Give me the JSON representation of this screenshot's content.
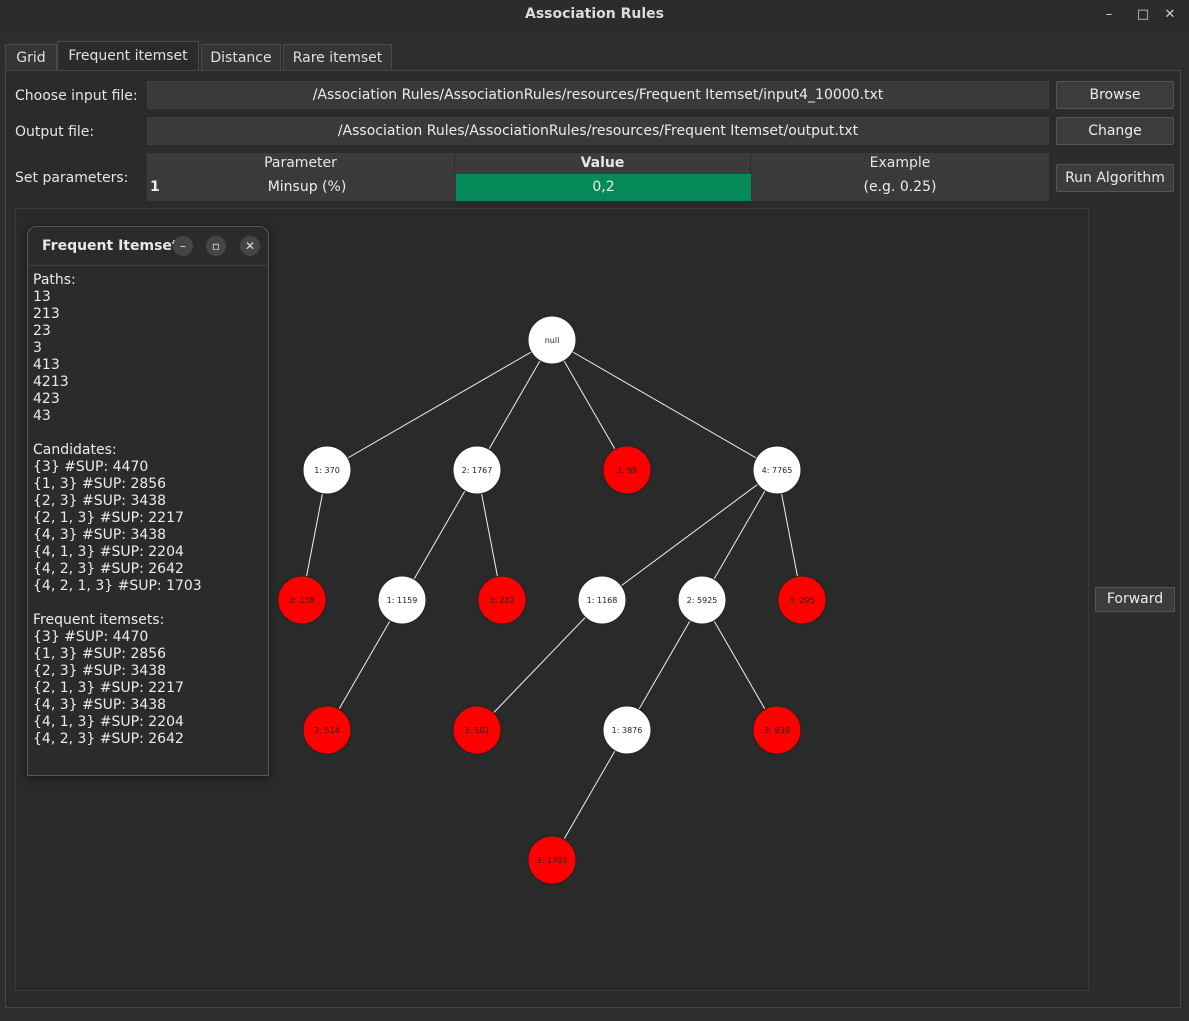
{
  "window": {
    "title": "Association Rules",
    "controls": [
      "–",
      "□",
      "✕"
    ]
  },
  "tabs": [
    "Grid",
    "Frequent itemset",
    "Distance",
    "Rare itemset"
  ],
  "active_tab": "Frequent itemset",
  "form": {
    "input_label": "Choose input file:",
    "input_value": "/Association Rules/AssociationRules/resources/Frequent Itemset/input4_10000.txt",
    "browse_label": "Browse",
    "output_label": "Output file:",
    "output_value": "/Association Rules/AssociationRules/resources/Frequent Itemset/output.txt",
    "change_label": "Change",
    "params_label": "Set parameters:",
    "run_label": "Run Algorithm"
  },
  "params_table": {
    "headers": [
      "Parameter",
      "Value",
      "Example"
    ],
    "rows": [
      {
        "index": "1",
        "parameter": "Minsup (%)",
        "value": "0,2",
        "example": "(e.g. 0.25)"
      }
    ]
  },
  "forward_label": "Forward",
  "colors": {
    "highlight": "#068a5a",
    "pruned": "#ff0000",
    "kept": "#ffffff"
  },
  "panel": {
    "title": "Frequent Itemset",
    "paths_heading": "Paths:",
    "paths": [
      "13",
      "213",
      "23",
      "3",
      "413",
      "4213",
      "423",
      "43"
    ],
    "candidates_heading": "Candidates:",
    "candidates": [
      "{3}  #SUP: 4470",
      "{1, 3}  #SUP: 2856",
      "{2, 3}  #SUP: 3438",
      "{2, 1, 3}  #SUP: 2217",
      "{4, 3}  #SUP: 3438",
      "{4, 1, 3}  #SUP: 2204",
      "{4, 2, 3}  #SUP: 2642",
      "{4, 2, 1, 3}  #SUP: 1703"
    ],
    "frequent_heading": "Frequent itemsets:",
    "frequent": [
      "{3}  #SUP: 4470",
      "{1, 3}  #SUP: 2856",
      "{2, 3}  #SUP: 3438",
      "{2, 1, 3}  #SUP: 2217",
      "{4, 3}  #SUP: 3438",
      "{4, 1, 3}  #SUP: 2204",
      "{4, 2, 3}  #SUP: 2642"
    ]
  },
  "tree": {
    "nodes": [
      {
        "id": "root",
        "label": "null",
        "state": "kept"
      },
      {
        "id": "n1",
        "label": "1: 370",
        "state": "kept",
        "parent": "root"
      },
      {
        "id": "n2",
        "label": "2: 1767",
        "state": "kept",
        "parent": "root"
      },
      {
        "id": "n3",
        "label": "3: 98",
        "state": "pruned",
        "parent": "root"
      },
      {
        "id": "n4",
        "label": "4: 7765",
        "state": "kept",
        "parent": "root"
      },
      {
        "id": "n13",
        "label": "3: 138",
        "state": "pruned",
        "parent": "n1"
      },
      {
        "id": "n21",
        "label": "1: 1159",
        "state": "kept",
        "parent": "n2"
      },
      {
        "id": "n23",
        "label": "3: 282",
        "state": "pruned",
        "parent": "n2"
      },
      {
        "id": "n41",
        "label": "1: 1168",
        "state": "kept",
        "parent": "n4"
      },
      {
        "id": "n42",
        "label": "2: 5925",
        "state": "kept",
        "parent": "n4"
      },
      {
        "id": "n43",
        "label": "3: 295",
        "state": "pruned",
        "parent": "n4"
      },
      {
        "id": "n213",
        "label": "3: 514",
        "state": "pruned",
        "parent": "n21"
      },
      {
        "id": "n413",
        "label": "3: 501",
        "state": "pruned",
        "parent": "n41"
      },
      {
        "id": "n421",
        "label": "1: 3876",
        "state": "kept",
        "parent": "n42"
      },
      {
        "id": "n423",
        "label": "3: 939",
        "state": "pruned",
        "parent": "n42"
      },
      {
        "id": "n4213",
        "label": "3: 1703",
        "state": "pruned",
        "parent": "n421"
      }
    ]
  }
}
